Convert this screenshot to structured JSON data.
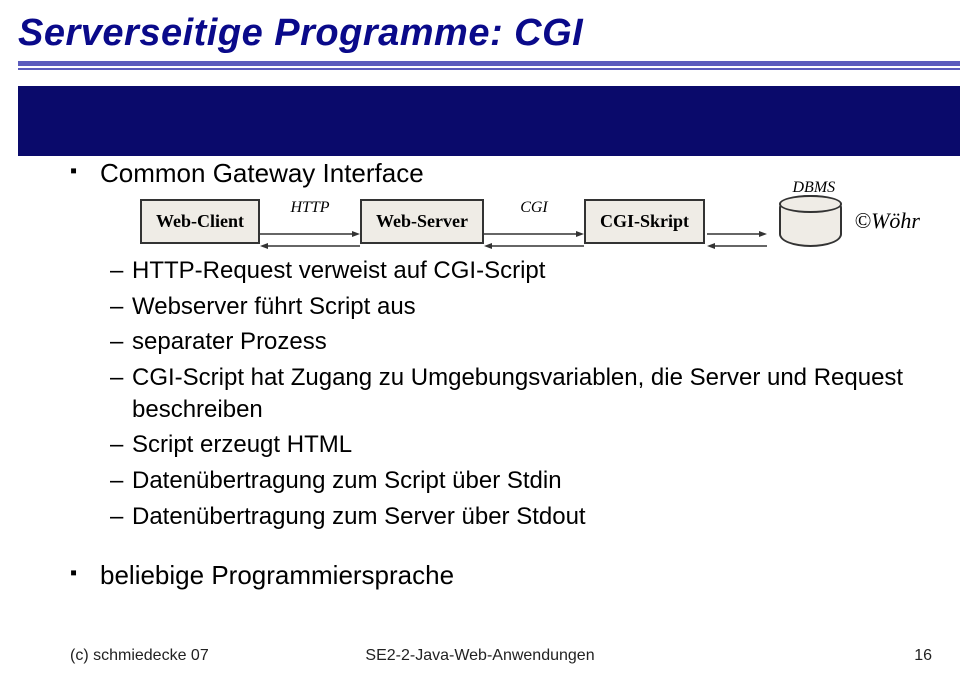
{
  "title": "Serverseitige Programme: CGI",
  "heading1": "Common Gateway Interface",
  "diagram": {
    "box1": "Web-Client",
    "conn1": "HTTP",
    "box2": "Web-Server",
    "conn2": "CGI",
    "box3": "CGI-Skript",
    "db": "DBMS"
  },
  "copyright": "©Wöhr",
  "sub": {
    "i1": "HTTP-Request verweist auf CGI-Script",
    "i2": "Webserver führt Script aus",
    "i3": "separater Prozess",
    "i4": "CGI-Script hat Zugang zu Umgebungsvariablen, die Server und Request beschreiben",
    "i5": "Script erzeugt HTML",
    "i6": "Datenübertragung zum Script über Stdin",
    "i7": "Datenübertragung zum Server über Stdout"
  },
  "heading2": "beliebige Programmiersprache",
  "footer": {
    "left": "(c) schmiedecke 07",
    "center": "SE2-2-Java-Web-Anwendungen",
    "right": "16"
  }
}
